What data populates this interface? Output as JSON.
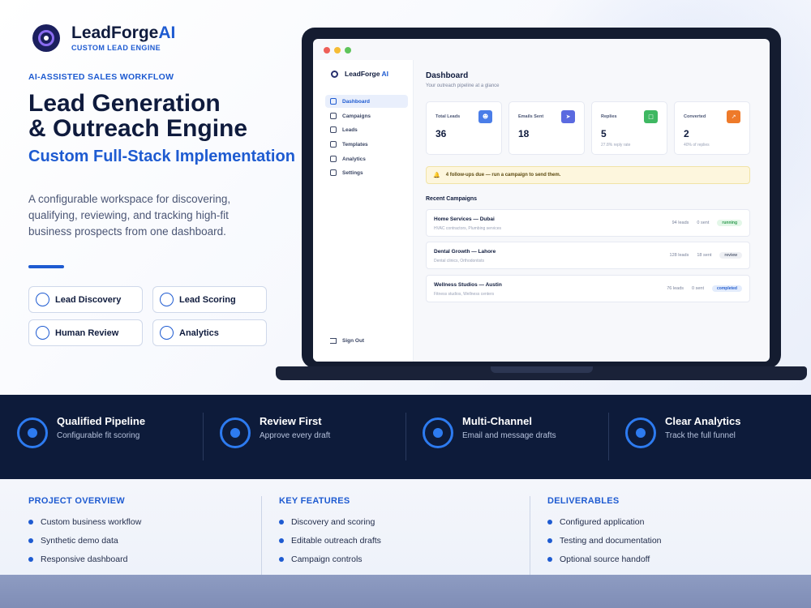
{
  "brand": {
    "name": "LeadForge",
    "name_suffix": "AI",
    "tagline": "CUSTOM LEAD ENGINE",
    "logo_icon": "target-logo-icon"
  },
  "hero": {
    "eyebrow": "AI-ASSISTED SALES WORKFLOW",
    "headline_line1": "Lead Generation",
    "headline_line2": "& Outreach Engine",
    "subhead": "Custom Full-Stack Implementation",
    "description": "A configurable workspace for discovering, qualifying, reviewing, and tracking high-fit business prospects from one dashboard.",
    "pills": [
      "Lead Discovery",
      "Lead Scoring",
      "Human Review",
      "Analytics"
    ]
  },
  "app": {
    "brand": "LeadForge",
    "brand_suffix": "AI",
    "nav": [
      {
        "label": "Dashboard",
        "icon": "grid-icon",
        "active": true
      },
      {
        "label": "Campaigns",
        "icon": "megaphone-icon"
      },
      {
        "label": "Leads",
        "icon": "users-icon"
      },
      {
        "label": "Templates",
        "icon": "document-icon"
      },
      {
        "label": "Analytics",
        "icon": "bar-chart-icon"
      },
      {
        "label": "Settings",
        "icon": "gear-icon"
      }
    ],
    "sign_out": "Sign Out",
    "title": "Dashboard",
    "subtitle": "Your outreach pipeline at a glance",
    "stats": [
      {
        "label": "Total Leads",
        "value": "36",
        "note": "",
        "icon": "users-icon",
        "color": "#4a7de8"
      },
      {
        "label": "Emails Sent",
        "value": "18",
        "note": "",
        "icon": "send-icon",
        "color": "#5b6ae0"
      },
      {
        "label": "Replies",
        "value": "5",
        "note": "27.8% reply rate",
        "icon": "message-icon",
        "color": "#3fb862"
      },
      {
        "label": "Converted",
        "value": "2",
        "note": "40% of replies",
        "icon": "trend-up-icon",
        "color": "#ee7a2a"
      }
    ],
    "alert": "4 follow-ups due — run a campaign to send them.",
    "recent_title": "Recent Campaigns",
    "campaigns": [
      {
        "name": "Home Services — Dubai",
        "desc": "HVAC contractors, Plumbing services",
        "leads": "94 leads",
        "sent": "0 sent",
        "status": "running"
      },
      {
        "name": "Dental Growth — Lahore",
        "desc": "Dental clinics, Orthodontists",
        "leads": "128 leads",
        "sent": "18 sent",
        "status": "review"
      },
      {
        "name": "Wellness Studios — Austin",
        "desc": "Fitness studios, Wellness centers",
        "leads": "76 leads",
        "sent": "0 sent",
        "status": "completed"
      }
    ]
  },
  "features": [
    {
      "title": "Qualified Pipeline",
      "sub": "Configurable fit scoring"
    },
    {
      "title": "Review First",
      "sub": "Approve every draft"
    },
    {
      "title": "Multi-Channel",
      "sub": "Email and message drafts"
    },
    {
      "title": "Clear Analytics",
      "sub": "Track the full funnel"
    }
  ],
  "columns": [
    {
      "heading": "PROJECT OVERVIEW",
      "items": [
        "Custom business workflow",
        "Synthetic demo data",
        "Responsive dashboard"
      ]
    },
    {
      "heading": "KEY FEATURES",
      "items": [
        "Discovery and scoring",
        "Editable outreach drafts",
        "Campaign controls"
      ]
    },
    {
      "heading": "DELIVERABLES",
      "items": [
        "Configured application",
        "Testing and documentation",
        "Optional source handoff"
      ]
    }
  ],
  "colors": {
    "accent": "#1e5bd1",
    "navy": "#0d1b3a"
  }
}
